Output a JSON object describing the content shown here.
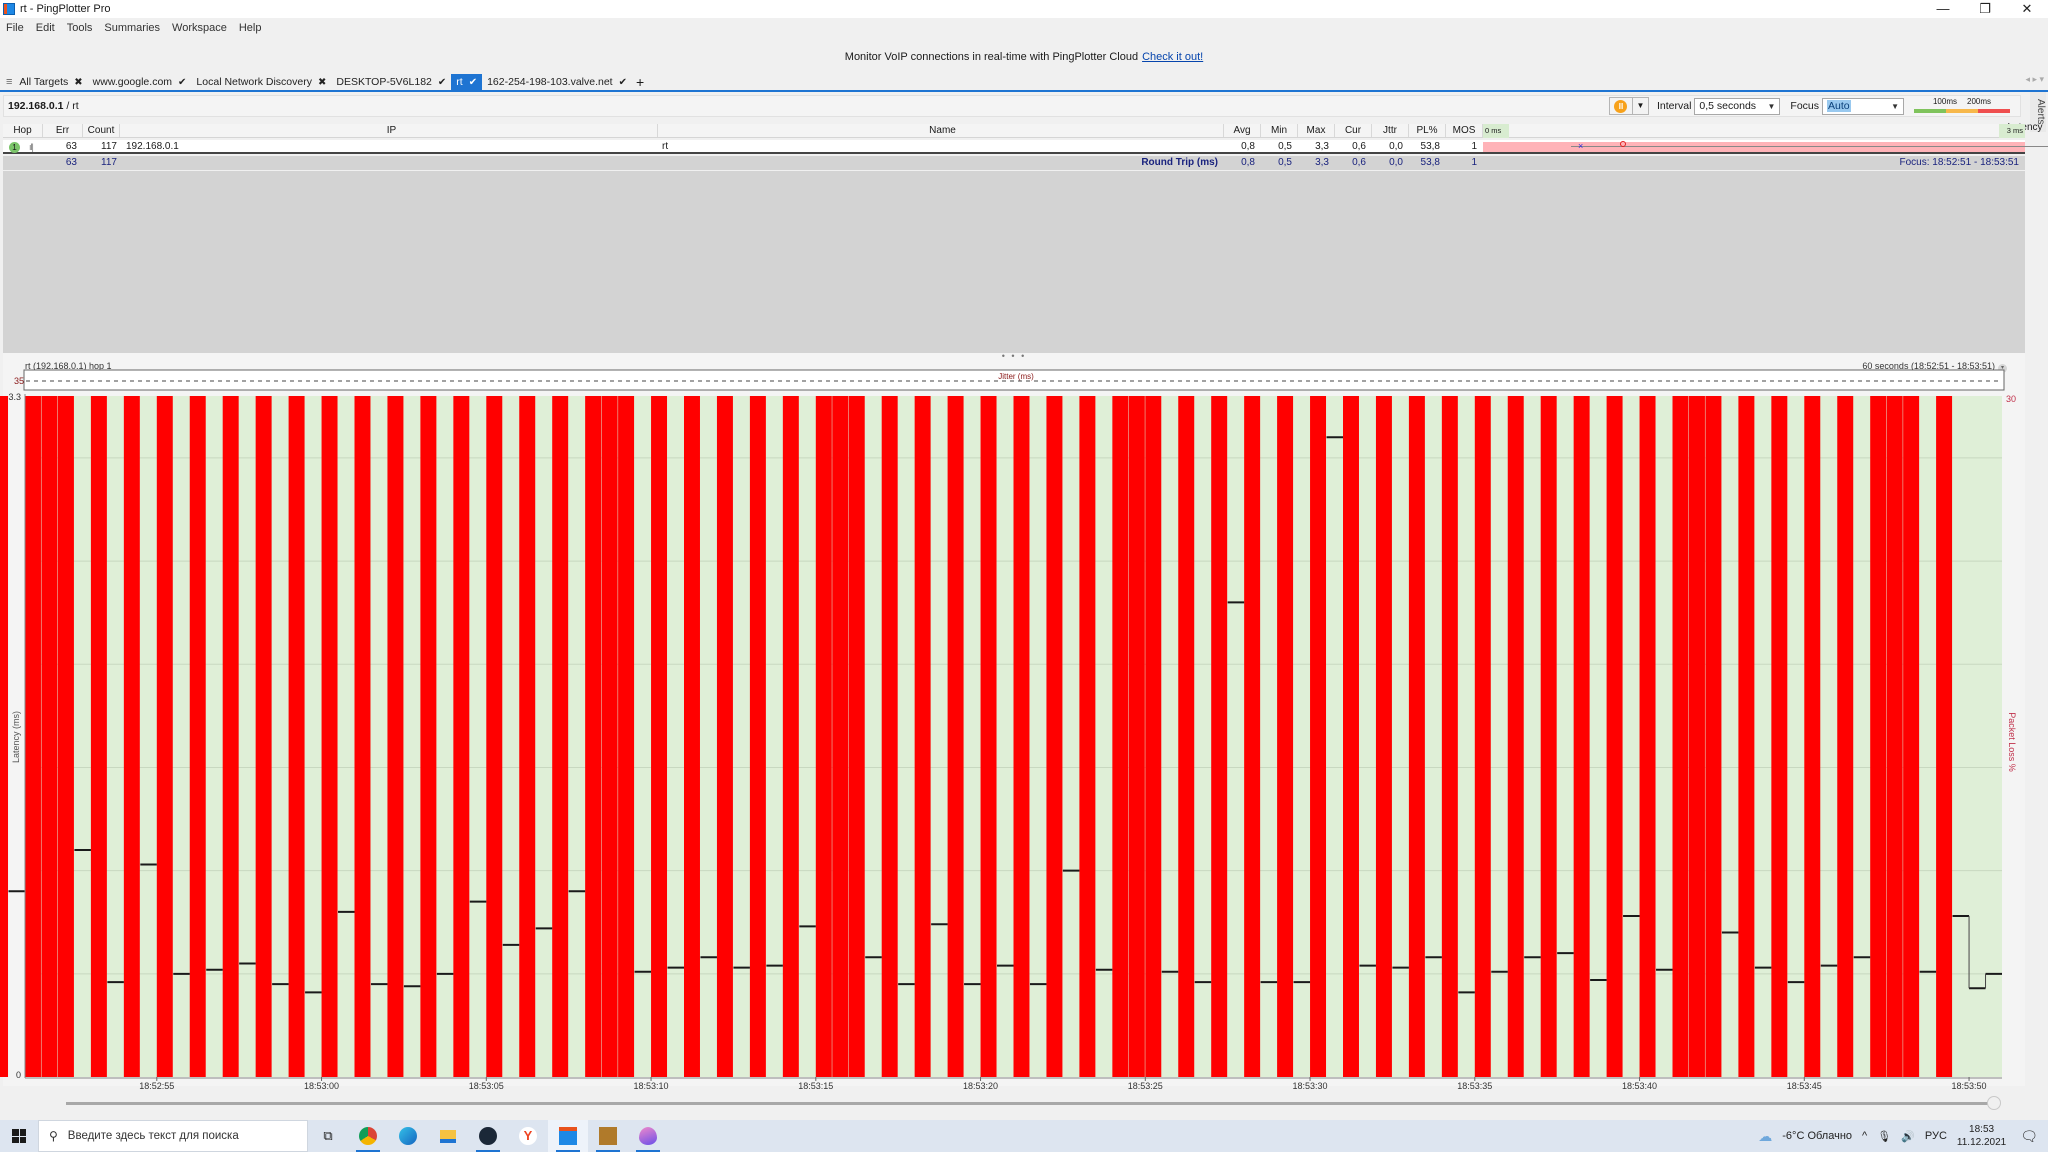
{
  "window": {
    "title": "rt - PingPlotter Pro",
    "controls": [
      "minimize",
      "restore",
      "close"
    ]
  },
  "menu": [
    "File",
    "Edit",
    "Tools",
    "Summaries",
    "Workspace",
    "Help"
  ],
  "promo": {
    "text": "Monitor VoIP connections in real-time with PingPlotter Cloud",
    "link": "Check it out!"
  },
  "tabs": [
    {
      "label": "All Targets",
      "mark": "✖",
      "active": false
    },
    {
      "label": "www.google.com",
      "mark": "✔",
      "active": false
    },
    {
      "label": "Local Network Discovery",
      "mark": "✖",
      "active": false
    },
    {
      "label": "DESKTOP-5V6L182",
      "mark": "✔",
      "active": false
    },
    {
      "label": "rt",
      "mark": "✔",
      "active": true
    },
    {
      "label": "162-254-198-103.valve.net",
      "mark": "✔",
      "active": false
    }
  ],
  "tab_add": "+",
  "breadcrumb": {
    "bold": "192.168.0.1",
    "rest": " / rt"
  },
  "toolbar": {
    "pause_glyph": "II",
    "interval_label": "Interval",
    "interval_value": "0,5 seconds",
    "focus_label": "Focus",
    "focus_value": "Auto",
    "legend_100": "100ms",
    "legend_200": "200ms",
    "colors": {
      "good": "#7fc35c",
      "warn": "#f7b84b",
      "bad": "#ef4f4f"
    }
  },
  "alerts_label": "Alerts",
  "grid": {
    "headers": {
      "hop": "Hop",
      "err": "Err",
      "count": "Count",
      "ip": "IP",
      "name": "Name",
      "avg": "Avg",
      "min": "Min",
      "max": "Max",
      "cur": "Cur",
      "jttr": "Jttr",
      "pl": "PL%",
      "mos": "MOS",
      "latency": "Latency",
      "lat_min": "0 ms",
      "lat_max": "3 ms"
    },
    "hops": [
      {
        "hop": "1",
        "err": "63",
        "count": "117",
        "ip": "192.168.0.1",
        "name": "rt",
        "avg": "0,8",
        "min": "0,5",
        "max": "3,3",
        "cur": "0,6",
        "jttr": "0,0",
        "pl": "53,8",
        "mos": "1"
      }
    ],
    "summary": {
      "err": "63",
      "count": "117",
      "label": "Round Trip (ms)",
      "avg": "0,8",
      "min": "0,5",
      "max": "3,3",
      "cur": "0,6",
      "jttr": "0,0",
      "pl": "53,8",
      "mos": "1",
      "focus": "Focus: 18:52:51 - 18:53:51"
    }
  },
  "splitter_glyph": "• • •",
  "chart_data": {
    "type": "bar",
    "title": "rt (192.168.0.1) hop 1",
    "range_label": "60 seconds (18:52:51 - 18:53:51)",
    "jitter_label": "Jitter (ms)",
    "jitter_max_label": "35",
    "ylabel": "Latency (ms)",
    "y2label": "Packet Loss %",
    "y2_top_label": "30",
    "ylim": [
      0,
      3.3
    ],
    "ytick_labels": [
      "3.3",
      "0"
    ],
    "gridlines_ms": [
      0.5,
      1.0,
      1.5,
      2.0,
      2.5,
      3.0
    ],
    "xlim_seconds": [
      0,
      60
    ],
    "xticks": [
      {
        "t": 4,
        "label": "18:52:55"
      },
      {
        "t": 9,
        "label": "18:53:00"
      },
      {
        "t": 14,
        "label": "18:53:05"
      },
      {
        "t": 19,
        "label": "18:53:10"
      },
      {
        "t": 24,
        "label": "18:53:15"
      },
      {
        "t": 29,
        "label": "18:53:20"
      },
      {
        "t": 34,
        "label": "18:53:25"
      },
      {
        "t": 39,
        "label": "18:53:30"
      },
      {
        "t": 44,
        "label": "18:53:35"
      },
      {
        "t": 49,
        "label": "18:53:40"
      },
      {
        "t": 54,
        "label": "18:53:45"
      },
      {
        "t": 59,
        "label": "18:53:50"
      }
    ],
    "sample_interval_s": 0.5,
    "note": "samples: null = lost packet (red bar), number = latency ms",
    "samples": [
      null,
      0.9,
      null,
      null,
      null,
      1.1,
      null,
      0.46,
      null,
      1.03,
      null,
      0.5,
      null,
      0.52,
      null,
      0.55,
      null,
      0.45,
      null,
      0.41,
      null,
      0.8,
      null,
      0.45,
      null,
      0.44,
      null,
      0.5,
      null,
      0.85,
      null,
      0.64,
      null,
      0.72,
      null,
      0.9,
      null,
      null,
      null,
      0.51,
      null,
      0.53,
      null,
      0.58,
      null,
      0.53,
      null,
      0.54,
      null,
      0.73,
      null,
      null,
      null,
      0.58,
      null,
      0.45,
      null,
      0.74,
      null,
      0.45,
      null,
      0.54,
      null,
      0.45,
      null,
      1.0,
      null,
      0.52,
      null,
      null,
      null,
      0.51,
      null,
      0.46,
      null,
      2.3,
      null,
      0.46,
      null,
      0.46,
      null,
      3.1,
      null,
      0.54,
      null,
      0.53,
      null,
      0.58,
      null,
      0.41,
      null,
      0.51,
      null,
      0.58,
      null,
      0.6,
      null,
      0.47,
      null,
      0.78,
      null,
      0.52,
      null,
      null,
      null,
      0.7,
      null,
      0.53,
      null,
      0.46,
      null,
      0.54,
      null,
      0.58,
      null,
      null,
      null,
      0.51,
      null,
      0.78,
      0.43,
      0.5
    ]
  },
  "taskbar": {
    "search_placeholder": "Введите здесь текст для поиска",
    "apps": [
      "task-view",
      "chrome",
      "edge",
      "file-explorer",
      "steam",
      "yandex-browser",
      "pingplotter",
      "counter-strike",
      "paint"
    ],
    "weather": "-6°C  Облачно",
    "lang": "РУС",
    "time": "18:53",
    "date": "11.12.2021"
  }
}
